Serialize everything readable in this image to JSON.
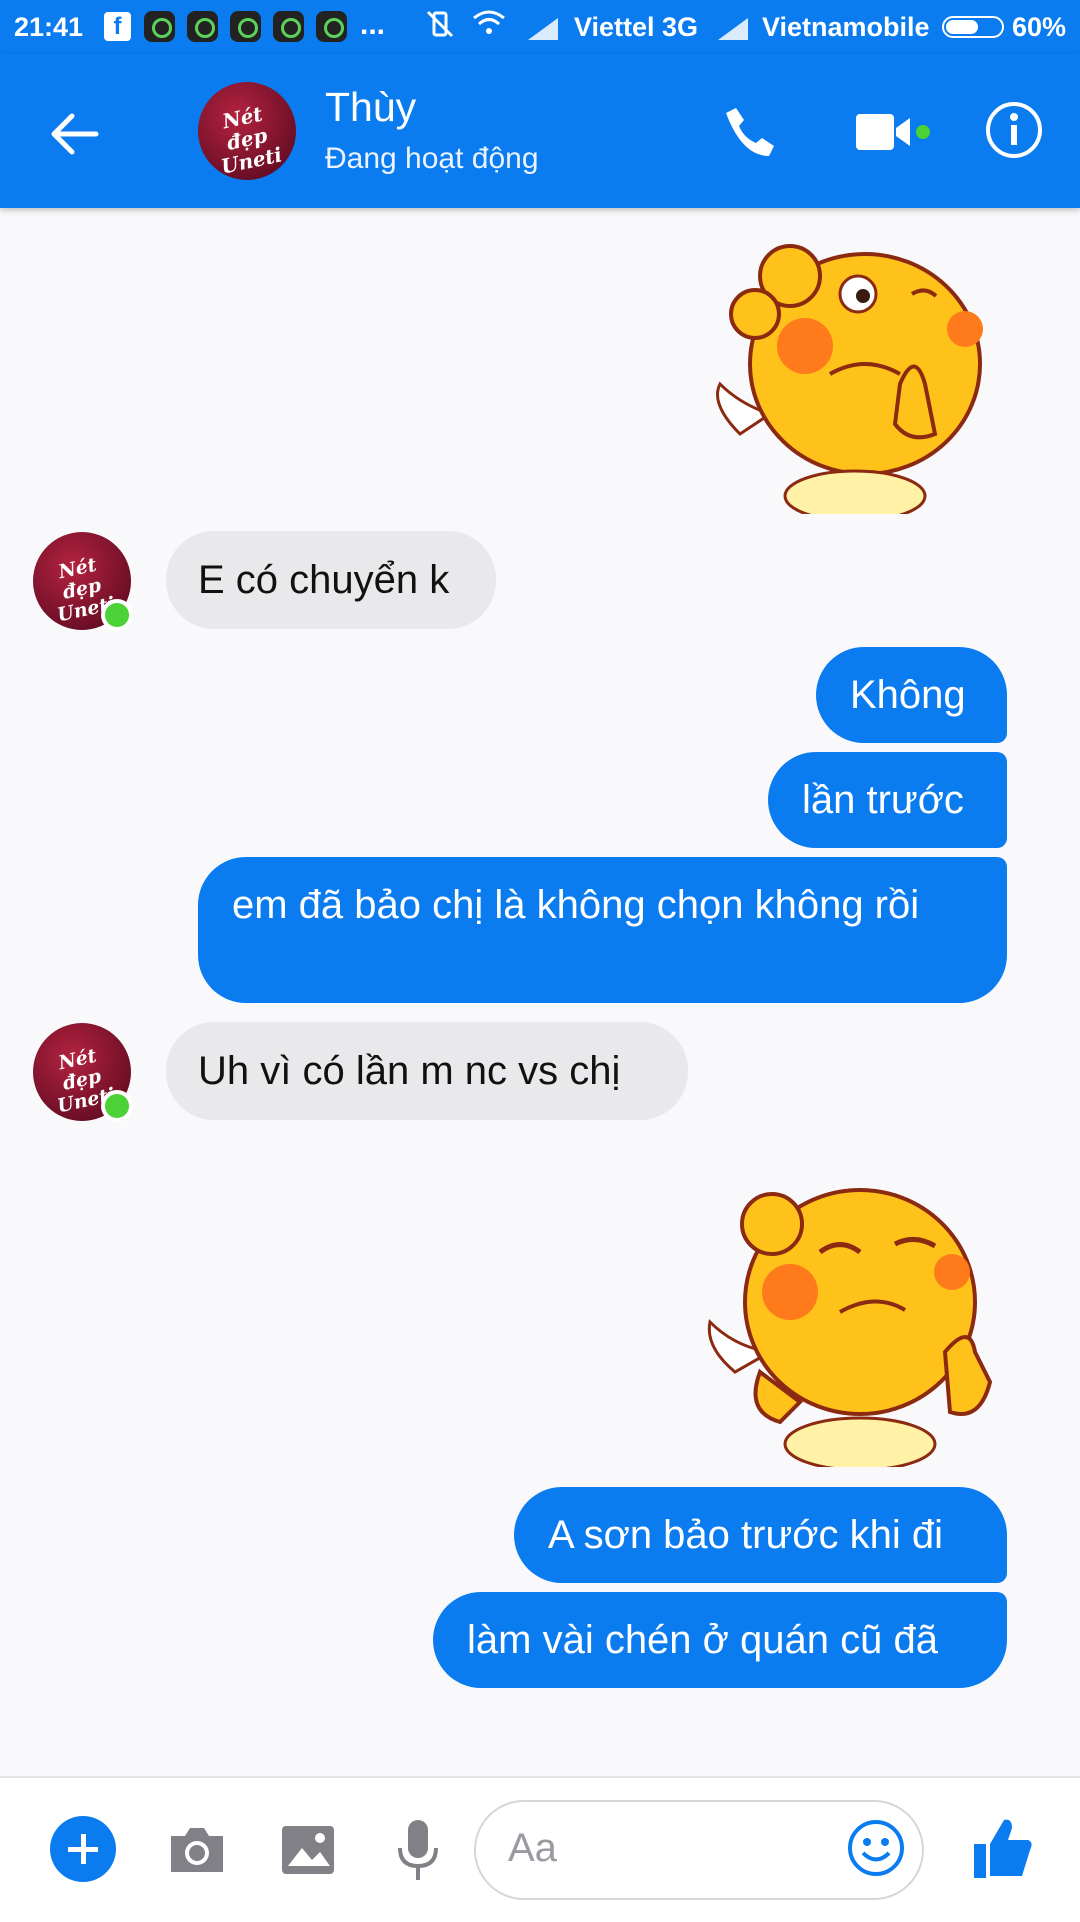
{
  "status_bar": {
    "time": "21:41",
    "facebook_badge": "f",
    "more": "...",
    "carrier_1": "Viettel 3G",
    "carrier_2": "Vietnamobile",
    "battery_level": 0.6,
    "battery_text": "60%"
  },
  "header": {
    "contact_name": "Thùy",
    "contact_status": "Đang hoạt động",
    "avatar_text": "Nét đẹp Uneti",
    "accent_color": "#0a7cf0",
    "online_color": "#4cd137"
  },
  "messages": [
    {
      "from": "me",
      "type": "sticker",
      "icon": "thinking-chick-sticker"
    },
    {
      "from": "them",
      "type": "text",
      "text": "E có chuyển k"
    },
    {
      "from": "me",
      "type": "text",
      "text": "Không"
    },
    {
      "from": "me",
      "type": "text",
      "text": "lần trước"
    },
    {
      "from": "me",
      "type": "text",
      "text": "em đã bảo chị là không chọn không rồi"
    },
    {
      "from": "them",
      "type": "text",
      "text": "Uh vì có lần m nc vs chị"
    },
    {
      "from": "me",
      "type": "sticker",
      "icon": "thumbs-up-chick-sticker"
    },
    {
      "from": "me",
      "type": "text",
      "text": "A sơn bảo trước khi đi"
    },
    {
      "from": "me",
      "type": "text",
      "text": "làm vài chén ở quán cũ đã"
    }
  ],
  "composer": {
    "placeholder": "Aa",
    "icons": [
      "plus-icon",
      "camera-icon",
      "image-icon",
      "mic-icon",
      "emoji-icon",
      "thumbs-up-icon"
    ]
  }
}
